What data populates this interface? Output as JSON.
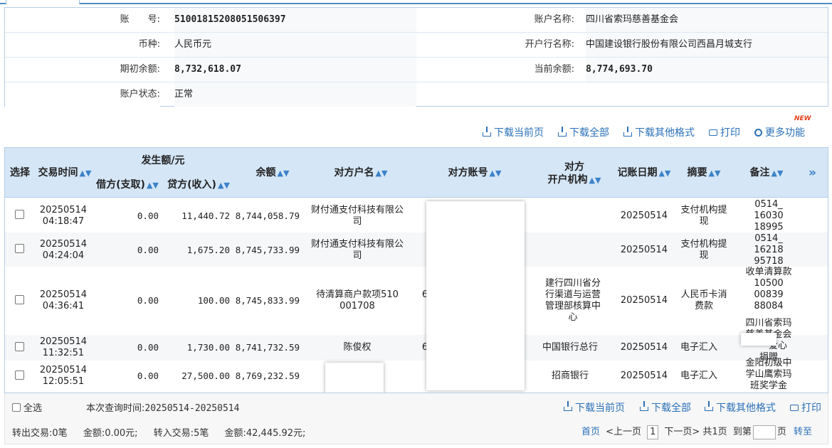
{
  "account": {
    "no_label": "账　　号:",
    "no_value": "51001815208051506397",
    "name_label": "账户名称:",
    "name_value": "四川省索玛慈善基金会",
    "currency_label": "币种:",
    "currency_value": "人民币元",
    "bank_label": "开户行名称:",
    "bank_value": "中国建设银行股份有限公司西昌月城支行",
    "open_balance_label": "期初余额:",
    "open_balance_value": "8,732,618.07",
    "current_balance_label": "当前余额:",
    "current_balance_value": "8,774,693.70",
    "status_label": "账户状态:",
    "status_value": "正常"
  },
  "actions": {
    "new_badge": "NEW",
    "download_page": "下载当前页",
    "download_all": "下载全部",
    "download_other": "下载其他格式",
    "print": "打印",
    "more": "更多功能"
  },
  "table": {
    "headers": {
      "select": "选择",
      "time": "交易时间",
      "amount_group": "发生额/元",
      "debit": "借方(支取)",
      "credit": "贷方(收入)",
      "balance": "余额",
      "counter_name": "对方户名",
      "counter_account": "对方账号",
      "counter_bank_1": "对方",
      "counter_bank_2": "开户机构",
      "book_date": "记账日期",
      "summary": "摘要",
      "remark": "备注",
      "more": "»"
    },
    "rows": [
      {
        "date": "20250514",
        "time": "04:18:47",
        "debit": "0.00",
        "credit": "11,440.72",
        "balance": "8,744,058.79",
        "counter_name_1": "财付通支付科技有限公",
        "counter_name_2": "司",
        "counter_account": "",
        "bank_1": "",
        "bank_2": "",
        "bank_3": "",
        "bank_4": "",
        "book_date": "20250514",
        "summary_1": "支付机构提",
        "summary_2": "现",
        "remark_1": "0514_",
        "remark_2": "16030",
        "remark_3": "18995"
      },
      {
        "date": "20250514",
        "time": "04:24:04",
        "debit": "0.00",
        "credit": "1,675.20",
        "balance": "8,745,733.99",
        "counter_name_1": "财付通支付科技有限公",
        "counter_name_2": "司",
        "counter_account": "",
        "bank_1": "",
        "bank_2": "",
        "bank_3": "",
        "bank_4": "",
        "book_date": "20250514",
        "summary_1": "支付机构提",
        "summary_2": "现",
        "remark_1": "0514_",
        "remark_2": "16218",
        "remark_3": "95718"
      },
      {
        "date": "20250514",
        "time": "04:36:41",
        "debit": "0.00",
        "credit": "100.00",
        "balance": "8,745,833.99",
        "counter_name_1": "待清算商户款项510",
        "counter_name_2": "001708",
        "counter_account": "6",
        "bank_1": "建行四川省分",
        "bank_2": "行渠道与运营",
        "bank_3": "管理部核算中",
        "bank_4": "心",
        "book_date": "20250514",
        "summary_1": "人民币卡消",
        "summary_2": "费款",
        "remark_1": "收单清算款",
        "remark_2": "10500",
        "remark_3": "00839",
        "remark_4": "88084"
      },
      {
        "date": "20250514",
        "time": "11:32:51",
        "debit": "0.00",
        "credit": "1,730.00",
        "balance": "8,741,732.59",
        "counter_name_1": "陈俊权",
        "counter_name_2": "",
        "counter_account": "6",
        "bank_1": "中国银行总行",
        "book_date": "20250514",
        "summary_1": "电子汇入",
        "summary_2": "",
        "remark_1": "四川省索玛",
        "remark_2": "慈善基金会",
        "remark_3": "爱心",
        "remark_4": "捐赠"
      },
      {
        "date": "20250514",
        "time": "12:05:51",
        "debit": "0.00",
        "credit": "27,500.00",
        "balance": "8,769,232.59",
        "counter_name_1": "",
        "counter_name_2": "",
        "counter_account": "",
        "bank_1": "招商银行",
        "book_date": "20250514",
        "summary_1": "电子汇入",
        "summary_2": "",
        "remark_1": "金阳初级中",
        "remark_2": "学山鹰索玛",
        "remark_3": "班奖学金"
      }
    ]
  },
  "footer": {
    "select_all": "全选",
    "query_time_label": "本次查询时间:",
    "query_time_value": "20250514-20250514",
    "download_page": "下载当前页",
    "download_all": "下载全部",
    "download_other": "下载其他格式",
    "print": "打印",
    "out_label": "转出交易:",
    "out_count": "0笔",
    "out_amount_label": "金额:",
    "out_amount": "0.00元;",
    "in_label": "转入交易:",
    "in_count": "5笔",
    "in_amount_label": "金额:",
    "in_amount": "42,445.92元;",
    "first_page": "首页",
    "prev_page": "<上一页",
    "page_no": "1",
    "next_page": "下一页>",
    "total_pages": "共1页",
    "goto_label": "到第",
    "page_unit": "页",
    "goto_btn": "转至"
  }
}
